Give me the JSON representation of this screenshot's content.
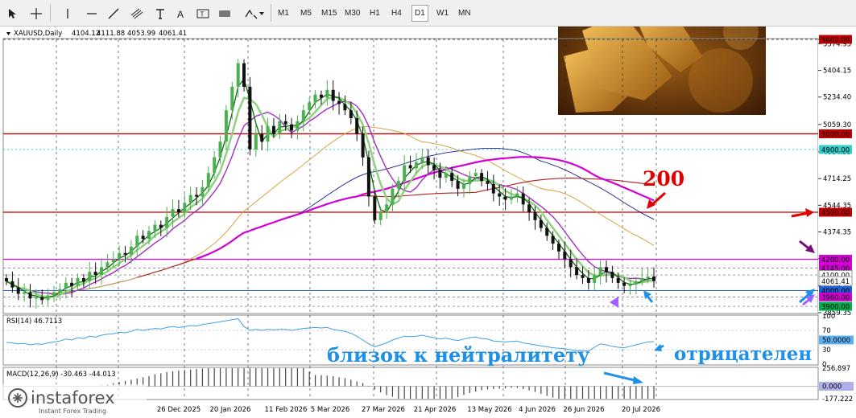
{
  "toolbar": {
    "icons": [
      "cursor-icon",
      "crosshair-icon",
      "vertical-line-icon",
      "horizontal-line-icon",
      "trendline-icon",
      "channel-icon",
      "text-icon",
      "text-label-icon",
      "rectangle-icon",
      "shapes-dropdown-icon"
    ],
    "timeframes": [
      "M1",
      "M5",
      "M15",
      "M30",
      "H1",
      "H4",
      "D1",
      "W1",
      "MN"
    ],
    "selected_timeframe": "D1"
  },
  "symbol": {
    "name": "XAUUSD,Daily",
    "open": "4104.12",
    "high": "4111.88",
    "low": "4053.99",
    "close": "4061.41"
  },
  "colors": {
    "bull": "#4caf50",
    "bear": "#111111",
    "red_line": "#c00000",
    "magenta": "#d200d2",
    "blue_annotation": "#1e90e6",
    "rsi_line": "#3ca0e6",
    "price_label_bg": "#505050"
  },
  "chart_data": [
    {
      "type": "line",
      "name": "price-panel",
      "ylim": [
        3859.35,
        5602.0
      ],
      "y_ticks": [
        "5602.00",
        "5574.95",
        "5404.15",
        "5234.40",
        "5059.30",
        "4884.55",
        "4714.25",
        "4544.35",
        "4374.35",
        "4204.25",
        "4029.30",
        "3859.35"
      ],
      "x_ticks": [
        "26 Dec 2025",
        "20 Jan 2026",
        "11 Feb 2026",
        "5 Mar 2026",
        "27 Mar 2026",
        "21 Apr 2026",
        "13 May 2026",
        "4 Jun 2026",
        "26 Jun 2026",
        "20 Jul 2026"
      ],
      "close": [
        4060,
        4020,
        3980,
        3990,
        3950,
        3960,
        3940,
        3970,
        3990,
        4010,
        4050,
        4030,
        4080,
        4060,
        4120,
        4100,
        4150,
        4180,
        4200,
        4240,
        4230,
        4280,
        4350,
        4330,
        4380,
        4420,
        4400,
        4470,
        4520,
        4500,
        4560,
        4610,
        4600,
        4660,
        4750,
        4850,
        4950,
        5150,
        5300,
        5450,
        5300,
        4900,
        5000,
        4950,
        5050,
        5000,
        5080,
        5060,
        5020,
        5080,
        5150,
        5200,
        5250,
        5230,
        5280,
        5210,
        5190,
        5150,
        5100,
        5000,
        4850,
        4600,
        4450,
        4500,
        4550,
        4650,
        4700,
        4800,
        4780,
        4820,
        4850,
        4800,
        4770,
        4720,
        4750,
        4700,
        4650,
        4680,
        4730,
        4750,
        4700,
        4680,
        4620,
        4600,
        4580,
        4600,
        4620,
        4550,
        4500,
        4450,
        4400,
        4350,
        4300,
        4250,
        4200,
        4150,
        4100,
        4080,
        4050,
        4100,
        4150,
        4120,
        4080,
        4050,
        4030,
        4040,
        4060,
        4080,
        4090,
        4061
      ],
      "lines": {
        "red_5000": 5000,
        "red_4500": 4500,
        "magenta_4200": 4200,
        "cyan_4900": 4900,
        "blue_4000": 4000,
        "dashed_5602": 5602,
        "dashed_4145": 4145,
        "dashed_4100": 4100,
        "dashed_3960": 3960,
        "dashed_3900": 3900
      },
      "price_labels": [
        {
          "text": "5602.00",
          "value": 5602,
          "bg": "#c00000"
        },
        {
          "text": "5000.00",
          "value": 5000,
          "bg": "#c00000"
        },
        {
          "text": "4900.00",
          "value": 4900,
          "bg": "#33cccc"
        },
        {
          "text": "4500.00",
          "value": 4500,
          "bg": "#c00000"
        },
        {
          "text": "4200.00",
          "value": 4200,
          "bg": "#d200d2"
        },
        {
          "text": "4145.00",
          "value": 4145,
          "bg": "#d200d2"
        },
        {
          "text": "4100.00",
          "value": 4100,
          "bg": "#ffffff"
        },
        {
          "text": "4061.41",
          "value": 4061.41,
          "bg": "#ffffff"
        },
        {
          "text": "4000.00",
          "value": 4000,
          "bg": "#1e60d8"
        },
        {
          "text": "3960.00",
          "value": 3960,
          "bg": "#d200d2"
        },
        {
          "text": "3900.00",
          "value": 3900,
          "bg": "#00b050"
        }
      ]
    },
    {
      "type": "line",
      "name": "rsi-panel",
      "label": "RSI(14) 46.7113",
      "ylim": [
        0,
        100
      ],
      "y_ticks": [
        "100",
        "70",
        "50.0000",
        "30",
        "0"
      ],
      "values": [
        45,
        44,
        42,
        43,
        40,
        42,
        41,
        44,
        46,
        48,
        52,
        50,
        55,
        53,
        58,
        56,
        60,
        62,
        63,
        66,
        65,
        68,
        72,
        70,
        72,
        74,
        73,
        76,
        78,
        76,
        78,
        80,
        79,
        82,
        84,
        86,
        88,
        90,
        92,
        94,
        78,
        70,
        72,
        70,
        72,
        71,
        72,
        72,
        70,
        72,
        74,
        75,
        76,
        75,
        76,
        72,
        70,
        68,
        64,
        58,
        50,
        42,
        36,
        40,
        44,
        50,
        54,
        58,
        57,
        58,
        60,
        57,
        55,
        52,
        54,
        51,
        49,
        52,
        55,
        56,
        53,
        52,
        48,
        47,
        46,
        47,
        48,
        44,
        42,
        40,
        38,
        36,
        34,
        33,
        32,
        30,
        28,
        28,
        27,
        35,
        42,
        40,
        37,
        35,
        34,
        37,
        40,
        43,
        46,
        46.7
      ]
    },
    {
      "type": "bar",
      "name": "macd-panel",
      "label": "MACD(12,26,9) -30.463 -44.013",
      "ylim": [
        -177.222,
        256.897
      ],
      "y_ticks": [
        "256.897",
        "0.000",
        "-177.222"
      ]
    }
  ],
  "annotations": {
    "label_200": "200",
    "near_neutral": "близок к нейтралитету",
    "negative": "отрицателен"
  },
  "branding": {
    "logo": "instaforex",
    "tagline": "Instant Forex Trading"
  }
}
